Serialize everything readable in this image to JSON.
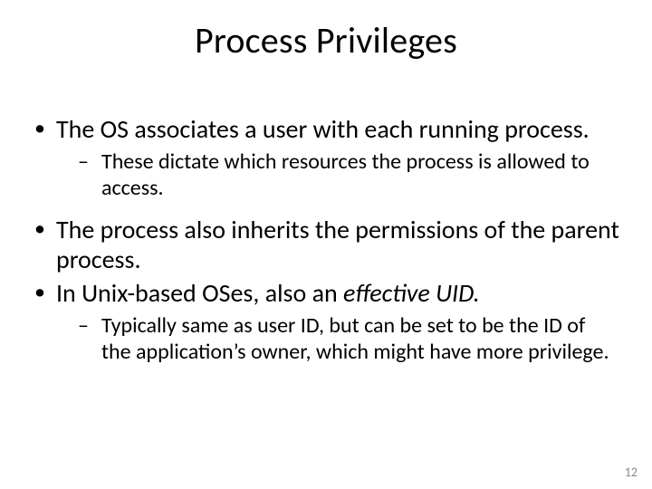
{
  "title": "Process Privileges",
  "bullets": {
    "b1": "The OS associates a user with each running process.",
    "b1s1": "These dictate which resources the process is allowed to access.",
    "b2": "The process also inherits the permissions of the parent process.",
    "b3_prefix": "In Unix-based OSes, also an ",
    "b3_italic": "effective UID.",
    "b3s1": "Typically same as user ID, but can be set to be the ID of the application’s owner, which might have more privilege."
  },
  "page_number": "12"
}
